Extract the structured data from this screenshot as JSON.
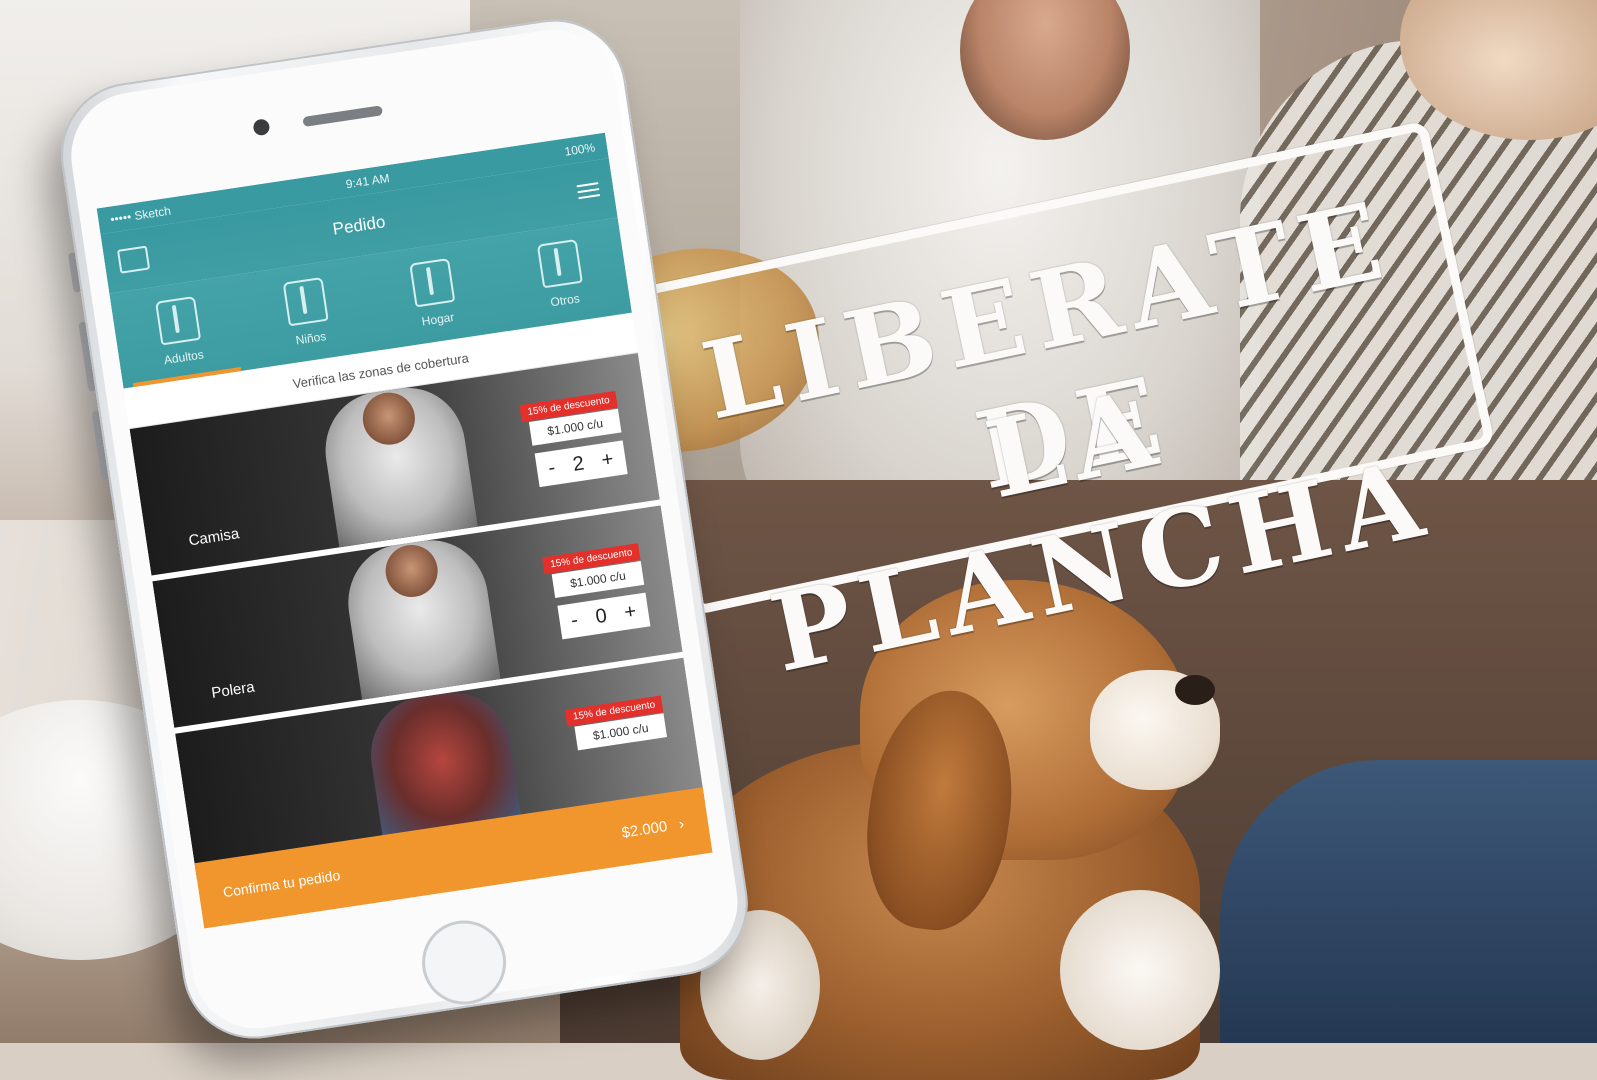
{
  "stamp": {
    "line1": "LIBERATE DE",
    "line2": "LA PLANCHA"
  },
  "app": {
    "status": {
      "carrier": "••••• Sketch",
      "time": "9:41 AM",
      "battery": "100%"
    },
    "header": {
      "title": "Pedido"
    },
    "categories": [
      {
        "label": "Adultos",
        "icon": "shirt-icon",
        "active": true
      },
      {
        "label": "Niños",
        "icon": "tshirt-icon",
        "active": false
      },
      {
        "label": "Hogar",
        "icon": "towel-icon",
        "active": false
      },
      {
        "label": "Otros",
        "icon": "jacket-icon",
        "active": false
      }
    ],
    "notice": "Verifica las zonas de cobertura",
    "products": [
      {
        "name": "Camisa",
        "discount": "15% de descuento",
        "price": "$1.000 c/u",
        "qty": "2",
        "minus": "-",
        "plus": "+"
      },
      {
        "name": "Polera",
        "discount": "15% de descuento",
        "price": "$1.000 c/u",
        "qty": "0",
        "minus": "-",
        "plus": "+"
      },
      {
        "name": "",
        "discount": "15% de descuento",
        "price": "$1.000 c/u"
      }
    ],
    "cta": {
      "label": "Confirma tu pedido",
      "total": "$2.000",
      "chevron": "›"
    },
    "colors": {
      "teal": "#3a9aa1",
      "orange": "#f1962d",
      "discount_red": "#e4302a"
    }
  }
}
